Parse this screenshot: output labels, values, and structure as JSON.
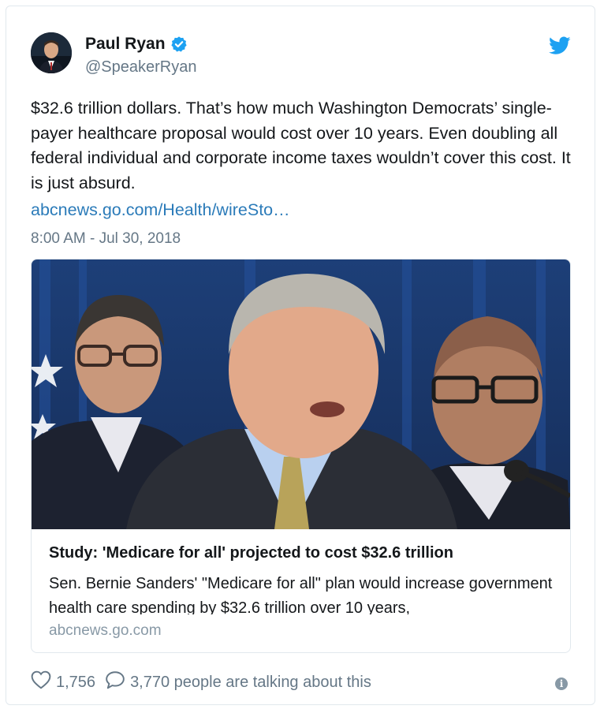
{
  "author": {
    "name": "Paul Ryan",
    "handle": "@SpeakerRyan"
  },
  "tweet": {
    "text": "$32.6 trillion dollars. That’s how much Washington Democrats’ single-payer healthcare proposal would cost over 10 years. Even doubling all federal individual and corporate income taxes wouldn’t cover this cost. It is just absurd.",
    "link": "abcnews.go.com/Health/wireSto…",
    "timestamp": "8:00 AM - Jul 30, 2018"
  },
  "card": {
    "title": "Study: 'Medicare for all' projected to cost $32.6 trillion",
    "description": "Sen. Bernie Sanders' \"Medicare for all\" plan would increase government health care spending by $32.6 trillion over 10 years,",
    "domain": "abcnews.go.com"
  },
  "actions": {
    "likes": "1,756",
    "replies": "3,770 people are talking about this"
  },
  "icons": {
    "verified": "verified-badge-icon",
    "brand": "twitter-bird-icon",
    "like": "heart-icon",
    "reply": "speech-bubble-icon",
    "info": "info-icon"
  },
  "colors": {
    "link": "#2b7bb9",
    "verified": "#1da1f2",
    "secondary_text": "#657786",
    "border": "#e1e8ed"
  }
}
